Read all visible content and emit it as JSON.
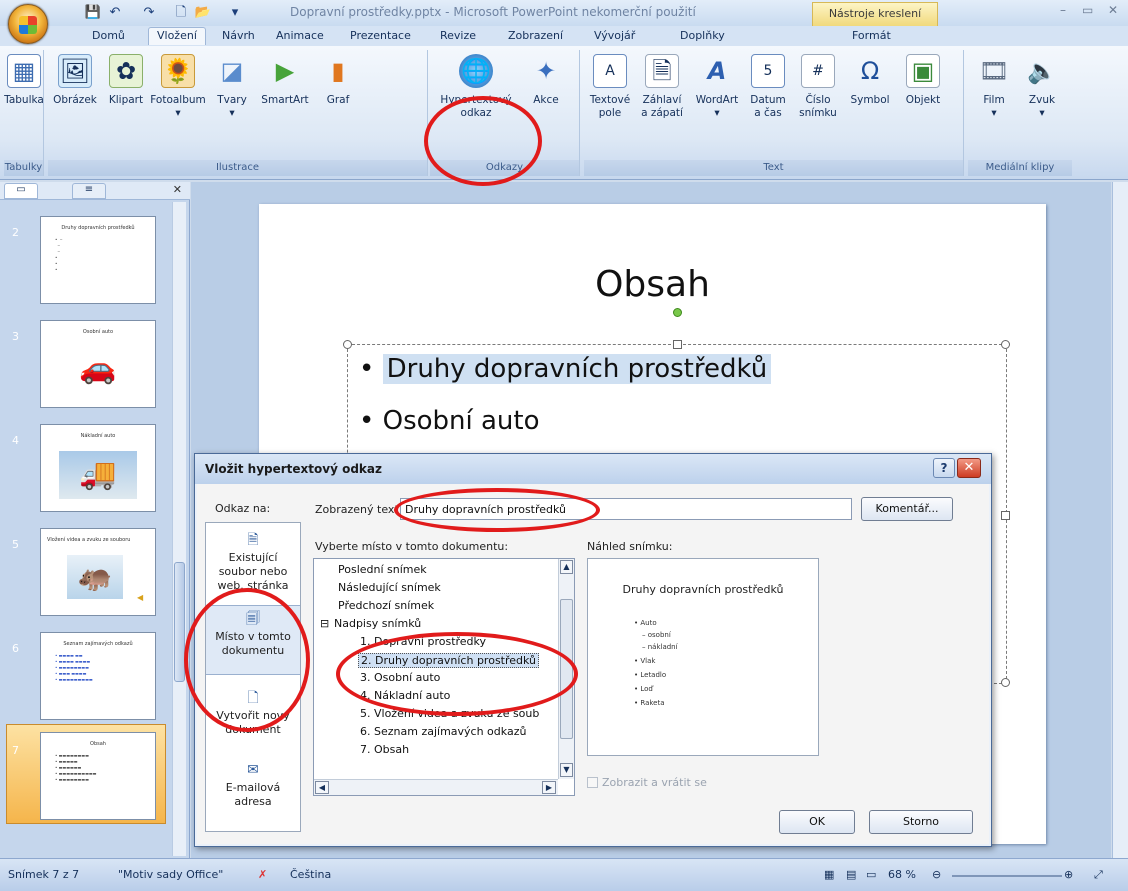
{
  "window": {
    "title": "Dopravní prostředky.pptx - Microsoft PowerPoint nekomerční použití",
    "contextual_tab": "Nástroje kreslení"
  },
  "tabs": [
    "Domů",
    "Vložení",
    "Návrh",
    "Animace",
    "Prezentace",
    "Revize",
    "Zobrazení",
    "Vývojář",
    "Doplňky",
    "Formát"
  ],
  "ribbon": {
    "groups": {
      "tables": "Tabulky",
      "illustrations": "Ilustrace",
      "links": "Odkazy",
      "text": "Text",
      "media": "Mediální klipy"
    },
    "buttons": {
      "table": "Tabulka",
      "picture": "Obrázek",
      "clipart": "Klipart",
      "photoalbum": "Fotoalbum",
      "shapes": "Tvary",
      "smartart": "SmartArt",
      "chart": "Graf",
      "hyperlink_1": "Hypertextový",
      "hyperlink_2": "odkaz",
      "action": "Akce",
      "textbox_1": "Textové",
      "textbox_2": "pole",
      "header_1": "Záhlaví",
      "header_2": "a zápatí",
      "wordart": "WordArt",
      "datetime_1": "Datum",
      "datetime_2": "a čas",
      "slidenum_1": "Číslo",
      "slidenum_2": "snímku",
      "symbol": "Symbol",
      "object": "Objekt",
      "movie": "Film",
      "sound": "Zvuk"
    }
  },
  "slides_panel": {
    "thumbs": [
      {
        "num": "2",
        "title": "Druhy dopravních prostředků"
      },
      {
        "num": "3",
        "title": "Osobní auto"
      },
      {
        "num": "4",
        "title": "Nákladní auto"
      },
      {
        "num": "5",
        "title": "Vložení videa a zvuku ze souboru"
      },
      {
        "num": "6",
        "title": "Seznam zajímavých odkazů"
      },
      {
        "num": "7",
        "title": "Obsah"
      }
    ]
  },
  "slide": {
    "title": "Obsah",
    "bullets": [
      "Druhy dopravních prostředků",
      "Osobní auto"
    ]
  },
  "dialog": {
    "title": "Vložit hypertextový odkaz",
    "help": "?",
    "link_to_label": "Odkaz na:",
    "link_to": {
      "existing_1": "Existující",
      "existing_2": "soubor nebo",
      "existing_3": "web. stránka",
      "place_1": "Místo v tomto",
      "place_2": "dokumentu",
      "new_1": "Vytvořit nový",
      "new_2": "dokument",
      "email_1": "E-mailová",
      "email_2": "adresa"
    },
    "display_text_label": "Zobrazený text:",
    "display_text_value": "Druhy dopravních prostředků",
    "comment_button": "Komentář...",
    "place_label": "Vyberte místo v tomto dokumentu:",
    "tree": {
      "last": "Poslední snímek",
      "next": "Následující snímek",
      "prev": "Předchozí snímek",
      "titles": "Nadpisy snímků",
      "items": [
        "1. Dopravní prostředky",
        "2. Druhy dopravních prostředků",
        "3. Osobní auto",
        "4. Nákladní auto",
        "5. Vložení videa a zvuku ze soub",
        "6. Seznam zajímavých odkazů",
        "7. Obsah"
      ]
    },
    "preview_label": "Náhled snímku:",
    "preview": {
      "title": "Druhy dopravních prostředků",
      "lines": [
        "• Auto",
        "– osobní",
        "– nákladní",
        "• Vlak",
        "• Letadlo",
        "• Loď",
        "• Raketa"
      ]
    },
    "show_and_return": "Zobrazit a vrátit se",
    "ok": "OK",
    "cancel": "Storno"
  },
  "statusbar": {
    "slide": "Snímek 7 z 7",
    "theme": "\"Motiv sady Office\"",
    "language": "Čeština",
    "zoom": "68 %"
  }
}
